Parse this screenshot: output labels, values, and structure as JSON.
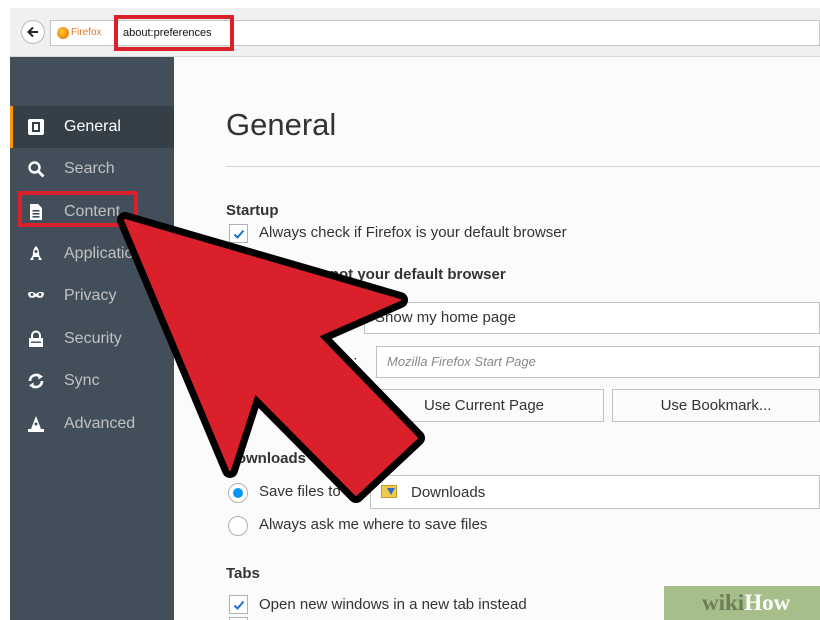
{
  "browser": {
    "brand_label": "Firefox",
    "url": "about:preferences"
  },
  "sidebar": {
    "items": [
      {
        "label": "General",
        "icon": "general-icon"
      },
      {
        "label": "Search",
        "icon": "search-icon"
      },
      {
        "label": "Content",
        "icon": "content-icon"
      },
      {
        "label": "Applications",
        "icon": "rocket-icon"
      },
      {
        "label": "Privacy",
        "icon": "mask-icon"
      },
      {
        "label": "Security",
        "icon": "lock-icon"
      },
      {
        "label": "Sync",
        "icon": "sync-icon"
      },
      {
        "label": "Advanced",
        "icon": "wizard-hat-icon"
      }
    ],
    "active_index": 0
  },
  "main": {
    "title": "General",
    "startup": {
      "heading": "Startup",
      "default_check_label": "Always check if Firefox is your default browser",
      "default_check_checked": true,
      "default_status": "Firefox is not your default browser",
      "when_starts_value": "Show my home page",
      "home_page_label": "Home Page:",
      "home_page_placeholder": "Mozilla Firefox Start Page",
      "use_current_label": "Use Current Page",
      "use_bookmark_label": "Use Bookmark..."
    },
    "downloads": {
      "heading": "Downloads",
      "save_files_label": "Save files to",
      "save_files_selected": true,
      "folder_name": "Downloads",
      "always_ask_label": "Always ask me where to save files"
    },
    "tabs": {
      "heading": "Tabs",
      "new_windows_label": "Open new windows in a new tab instead",
      "new_windows_checked": true
    }
  },
  "annotation": {
    "color": "#d9202b"
  },
  "watermark": {
    "part1": "wiki",
    "part2": "How"
  }
}
